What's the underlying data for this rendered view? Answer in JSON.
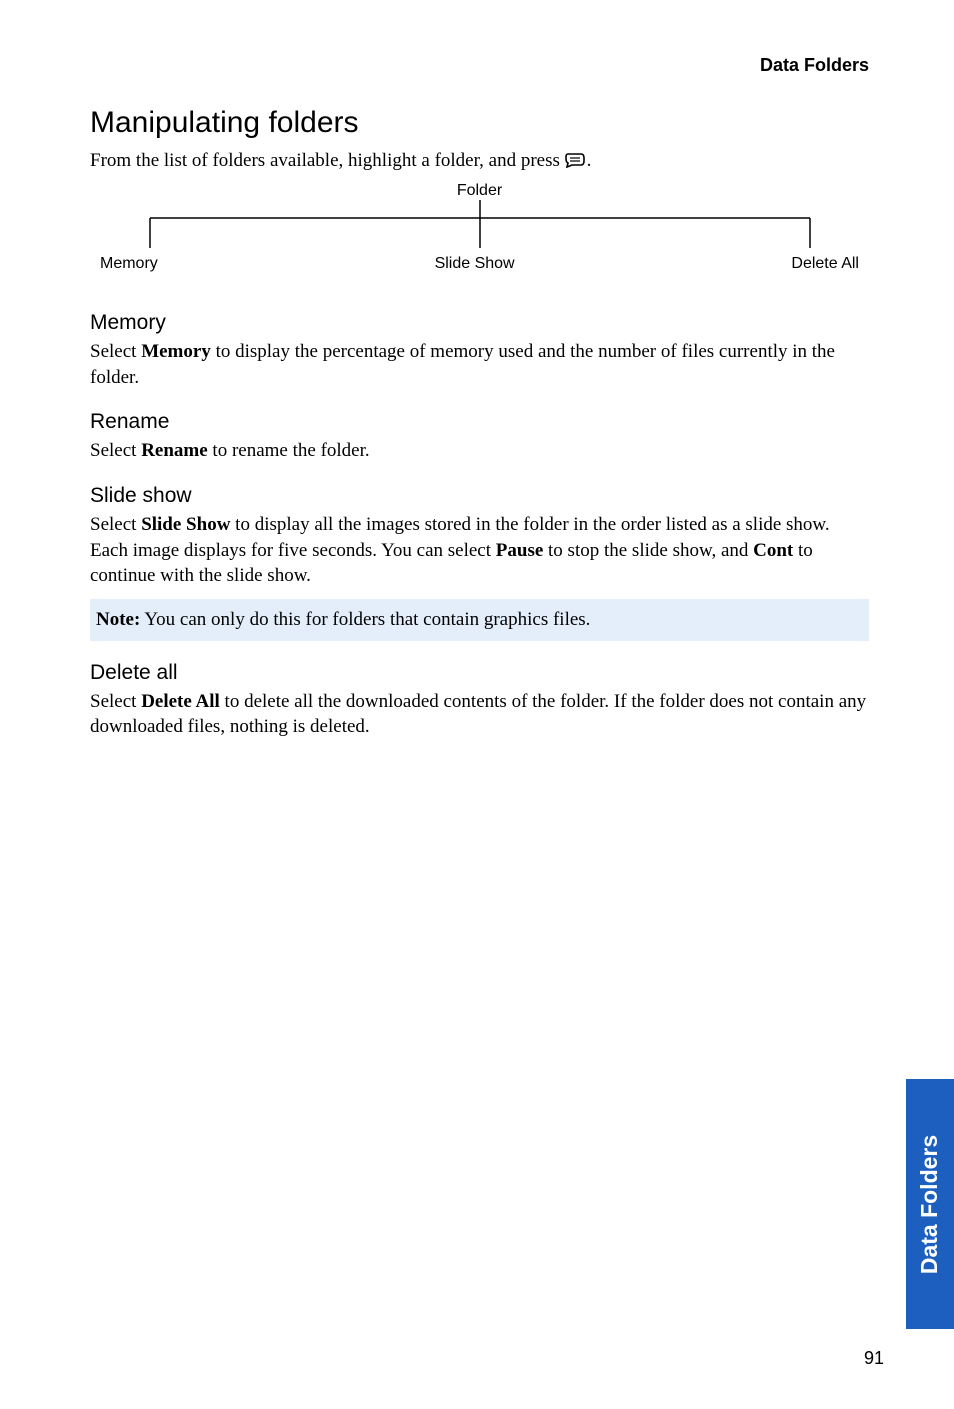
{
  "header": {
    "title": "Data Folders"
  },
  "h1": "Manipulating folders",
  "intro": {
    "pre": "From the list of folders available, highlight a folder, and press ",
    "post": "."
  },
  "diagram": {
    "root": "Folder",
    "leaves": {
      "left": "Memory",
      "center": "Slide Show",
      "right": "Delete All"
    }
  },
  "sections": {
    "memory": {
      "heading": "Memory",
      "pre": "Select ",
      "bold": "Memory",
      "post": " to display the percentage of memory used and the number of files currently in the folder."
    },
    "rename": {
      "heading": "Rename",
      "pre": "Select ",
      "bold": "Rename",
      "post": " to rename the folder."
    },
    "slideshow": {
      "heading": "Slide show",
      "pre": "Select ",
      "bold": "Slide Show",
      "mid1": " to display all the images stored in the folder in the order listed as a slide show. Each image displays for five seconds. You can select ",
      "bold2": "Pause",
      "mid2": " to stop the slide show, and ",
      "bold3": "Cont",
      "post": " to continue with the slide show."
    },
    "note": {
      "label": "Note:",
      "text": " You can only do this for folders that contain graphics files."
    },
    "deleteall": {
      "heading": "Delete all",
      "pre": "Select ",
      "bold": "Delete All",
      "post": " to delete all the downloaded contents of the folder. If the folder does not contain any downloaded files, nothing is deleted."
    }
  },
  "sideTab": "Data Folders",
  "pageNumber": "91"
}
